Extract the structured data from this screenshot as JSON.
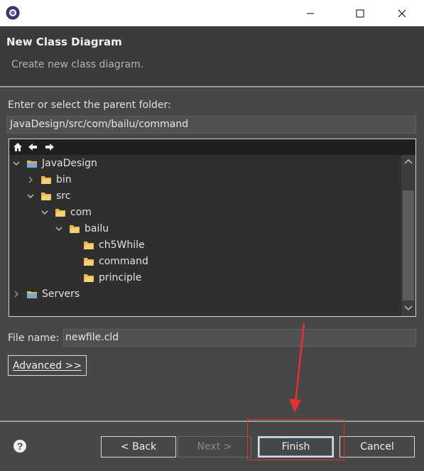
{
  "window": {
    "minimize_icon": "minimize-icon",
    "maximize_icon": "maximize-icon",
    "close_icon": "close-icon"
  },
  "header": {
    "title": "New Class Diagram",
    "description": "Create new class diagram."
  },
  "parent_folder": {
    "label": "Enter or select the parent folder:",
    "value": "JavaDesign/src/com/bailu/command"
  },
  "tree": {
    "toolbar_icons": [
      "home-icon",
      "back-arrow-icon",
      "forward-arrow-icon"
    ],
    "items": [
      {
        "label": "JavaDesign",
        "expanded": true,
        "depth": 0,
        "type": "project"
      },
      {
        "label": "bin",
        "expanded": false,
        "depth": 1,
        "type": "folder"
      },
      {
        "label": "src",
        "expanded": true,
        "depth": 1,
        "type": "folder"
      },
      {
        "label": "com",
        "expanded": true,
        "depth": 2,
        "type": "folder"
      },
      {
        "label": "bailu",
        "expanded": true,
        "depth": 3,
        "type": "folder"
      },
      {
        "label": "ch5While",
        "depth": 4,
        "type": "folder"
      },
      {
        "label": "command",
        "depth": 4,
        "type": "folder"
      },
      {
        "label": "principle",
        "depth": 4,
        "type": "folder"
      },
      {
        "label": "Servers",
        "expanded": false,
        "depth": 0,
        "type": "project"
      }
    ]
  },
  "file_name": {
    "label": "File name:",
    "value": "newfile.cld"
  },
  "advanced_button": "Advanced >>",
  "buttons": {
    "back": "< Back",
    "next": "Next >",
    "finish": "Finish",
    "cancel": "Cancel"
  },
  "colors": {
    "accent_folder": "#e8b84a",
    "highlight": "#e83030"
  }
}
